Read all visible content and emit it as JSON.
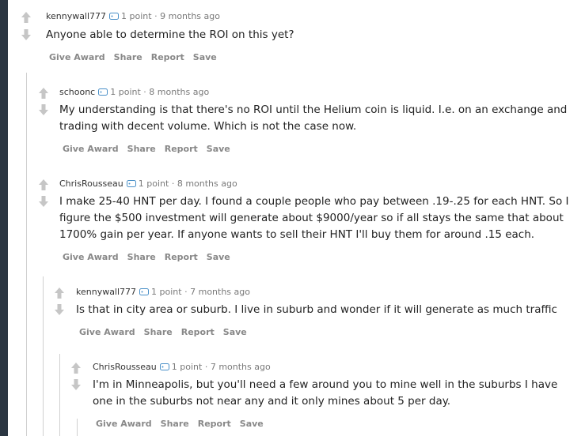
{
  "comments": [
    {
      "author": "kennywall777",
      "points": "1 point",
      "sep": "·",
      "time": "9 months ago",
      "lines": [
        "Anyone able to determine the ROI on this yet?"
      ],
      "actions": [
        "Give Award",
        "Share",
        "Report",
        "Save"
      ]
    },
    {
      "author": "schoonc",
      "points": "1 point",
      "sep": "·",
      "time": "8 months ago",
      "lines": [
        "My understanding is that there's no ROI until the Helium coin is liquid. I.e. on an exchange and",
        "trading with decent volume. Which is not the case now."
      ],
      "actions": [
        "Give Award",
        "Share",
        "Report",
        "Save"
      ]
    },
    {
      "author": "ChrisRousseau",
      "points": "1 point",
      "sep": "·",
      "time": "8 months ago",
      "lines": [
        "I make 25-40 HNT per day. I found a couple people who pay between .19-.25 for each HNT. So I",
        "figure the $500 investment will generate about $9000/year so if all stays the same that about",
        "1700% gain per year. If anyone wants to sell their HNT I'll buy them for around .15 each."
      ],
      "actions": [
        "Give Award",
        "Share",
        "Report",
        "Save"
      ]
    },
    {
      "author": "kennywall777",
      "points": "1 point",
      "sep": "·",
      "time": "7 months ago",
      "lines": [
        "Is that in city area or suburb. I live in suburb and wonder if it will generate as much traffic"
      ],
      "actions": [
        "Give Award",
        "Share",
        "Report",
        "Save"
      ]
    },
    {
      "author": "ChrisRousseau",
      "points": "1 point",
      "sep": "·",
      "time": "7 months ago",
      "lines": [
        "I'm in Minneapolis, but you'll need a few around you to mine well in the suburbs I have",
        "one in the suburbs not near any and it only mines about 5 per day."
      ],
      "actions": [
        "Give Award",
        "Share",
        "Report",
        "Save"
      ]
    }
  ]
}
